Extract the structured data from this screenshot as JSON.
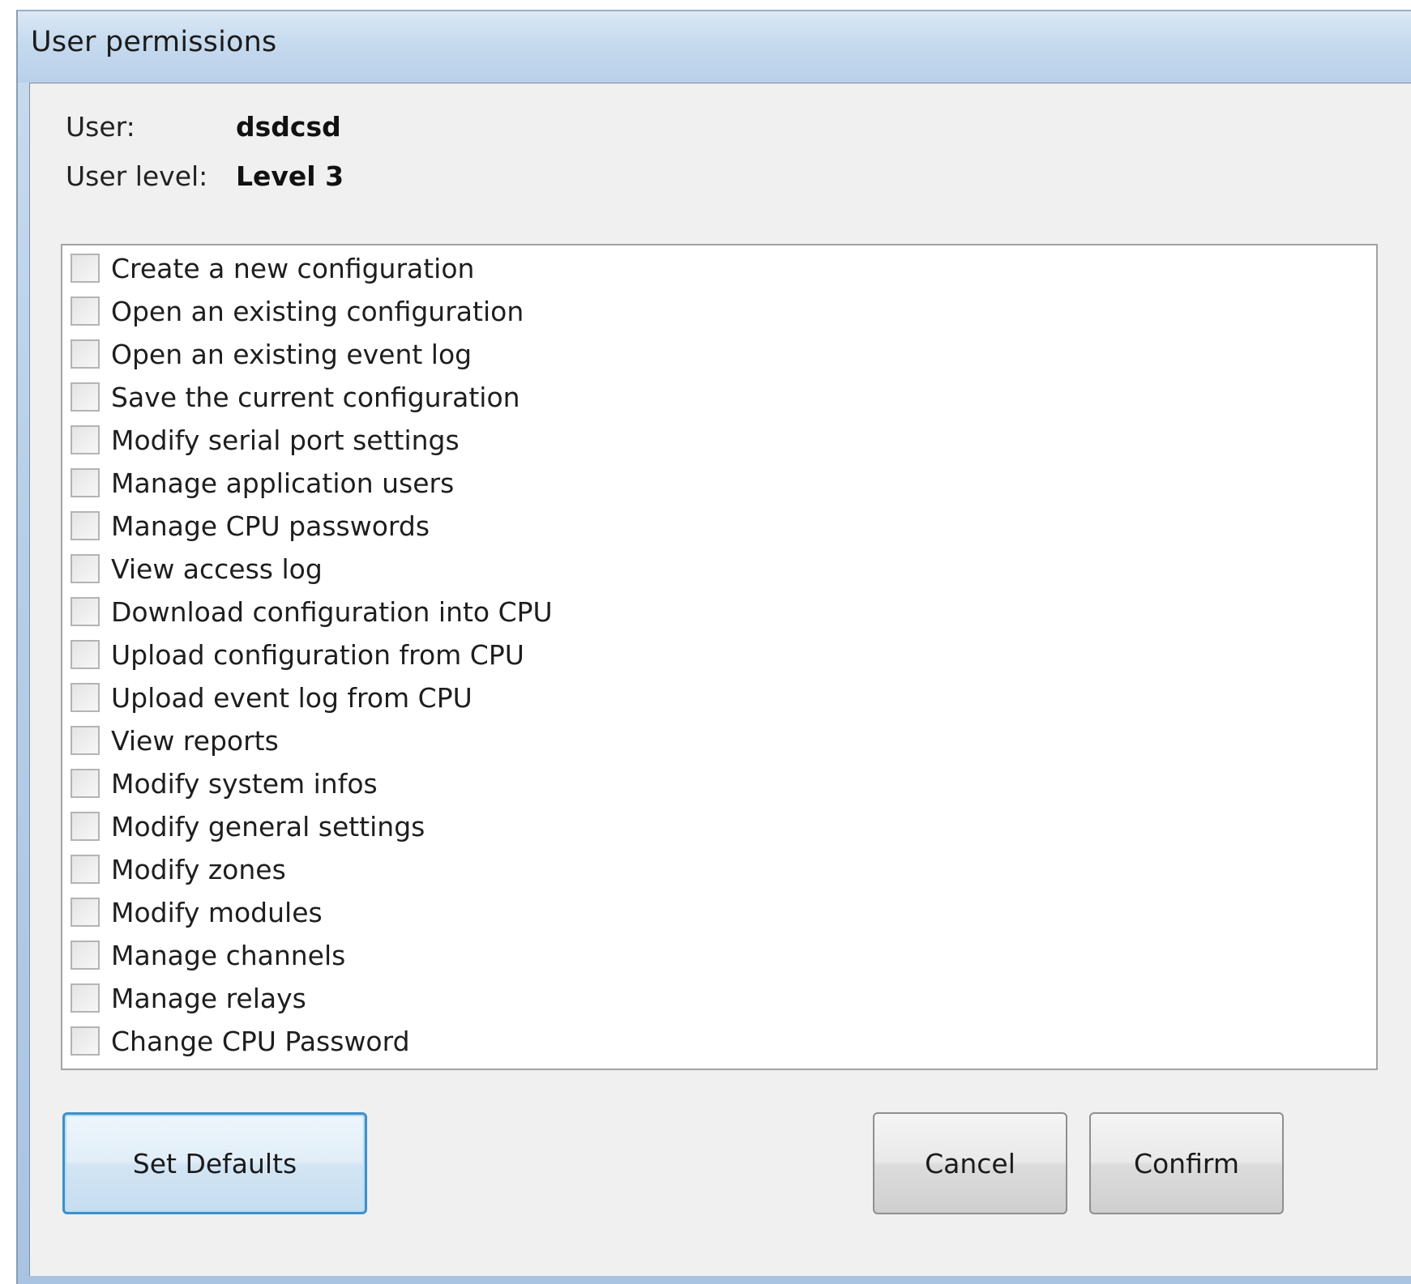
{
  "window": {
    "title": "User permissions"
  },
  "info": {
    "user_label": "User:",
    "user_value": "dsdcsd",
    "level_label": "User level:",
    "level_value": "Level 3"
  },
  "permissions": [
    {
      "label": "Create a new configuration",
      "checked": false
    },
    {
      "label": "Open an existing configuration",
      "checked": false
    },
    {
      "label": "Open an existing event log",
      "checked": false
    },
    {
      "label": "Save the current configuration",
      "checked": false
    },
    {
      "label": "Modify serial port settings",
      "checked": false
    },
    {
      "label": "Manage application users",
      "checked": false
    },
    {
      "label": "Manage CPU passwords",
      "checked": false
    },
    {
      "label": "View access log",
      "checked": false
    },
    {
      "label": "Download configuration into CPU",
      "checked": false
    },
    {
      "label": "Upload configuration from CPU",
      "checked": false
    },
    {
      "label": "Upload event log from CPU",
      "checked": false
    },
    {
      "label": "View reports",
      "checked": false
    },
    {
      "label": "Modify system infos",
      "checked": false
    },
    {
      "label": "Modify general settings",
      "checked": false
    },
    {
      "label": "Modify zones",
      "checked": false
    },
    {
      "label": "Modify modules",
      "checked": false
    },
    {
      "label": "Manage channels",
      "checked": false
    },
    {
      "label": "Manage relays",
      "checked": false
    },
    {
      "label": "Change CPU Password",
      "checked": false
    }
  ],
  "buttons": {
    "set_defaults": "Set Defaults",
    "cancel": "Cancel",
    "confirm": "Confirm"
  }
}
